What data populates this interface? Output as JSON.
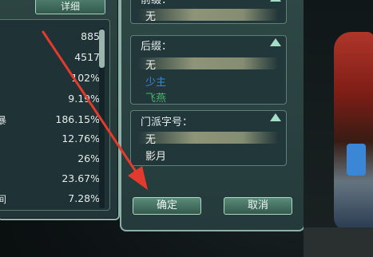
{
  "left_panel": {
    "detail_button": "详细",
    "stats": [
      {
        "label": "",
        "value": "885"
      },
      {
        "label": "",
        "value": "4517"
      },
      {
        "label": "",
        "value": "102%"
      },
      {
        "label": "",
        "value": "9.19%"
      },
      {
        "label": "暴",
        "value": "186.15%"
      },
      {
        "label": "",
        "value": "12.76%"
      },
      {
        "label": "",
        "value": "26%"
      },
      {
        "label": "",
        "value": "23.67%"
      },
      {
        "label": "间",
        "value": "7.28%"
      }
    ]
  },
  "right_panel": {
    "prefix": {
      "title": "前缀：",
      "options": [
        "无"
      ]
    },
    "suffix": {
      "title": "后缀：",
      "options": [
        "无",
        "少主",
        "飞燕"
      ]
    },
    "sect_title": {
      "title": "门派字号：",
      "options": [
        "无",
        "影月"
      ]
    },
    "confirm_button": "确定",
    "cancel_button": "取消"
  },
  "colors": {
    "arrow": "#e23b2e",
    "highlight": "#e6e1aa",
    "panel": "#2a4240",
    "option_blue": "#3a86d8",
    "option_green": "#43b56b"
  }
}
